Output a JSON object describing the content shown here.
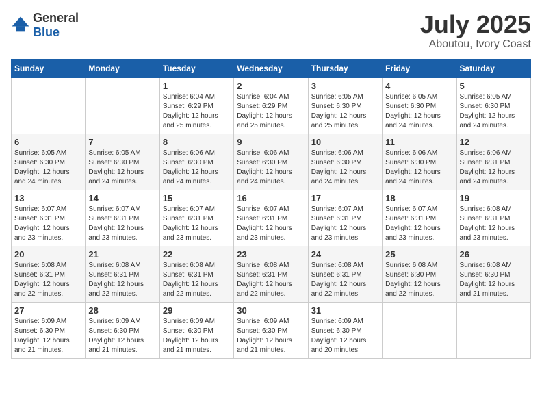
{
  "header": {
    "logo_general": "General",
    "logo_blue": "Blue",
    "month": "July 2025",
    "location": "Aboutou, Ivory Coast"
  },
  "days_of_week": [
    "Sunday",
    "Monday",
    "Tuesday",
    "Wednesday",
    "Thursday",
    "Friday",
    "Saturday"
  ],
  "weeks": [
    [
      {
        "day": "",
        "info": ""
      },
      {
        "day": "",
        "info": ""
      },
      {
        "day": "1",
        "info": "Sunrise: 6:04 AM\nSunset: 6:29 PM\nDaylight: 12 hours and 25 minutes."
      },
      {
        "day": "2",
        "info": "Sunrise: 6:04 AM\nSunset: 6:29 PM\nDaylight: 12 hours and 25 minutes."
      },
      {
        "day": "3",
        "info": "Sunrise: 6:05 AM\nSunset: 6:30 PM\nDaylight: 12 hours and 25 minutes."
      },
      {
        "day": "4",
        "info": "Sunrise: 6:05 AM\nSunset: 6:30 PM\nDaylight: 12 hours and 24 minutes."
      },
      {
        "day": "5",
        "info": "Sunrise: 6:05 AM\nSunset: 6:30 PM\nDaylight: 12 hours and 24 minutes."
      }
    ],
    [
      {
        "day": "6",
        "info": "Sunrise: 6:05 AM\nSunset: 6:30 PM\nDaylight: 12 hours and 24 minutes."
      },
      {
        "day": "7",
        "info": "Sunrise: 6:05 AM\nSunset: 6:30 PM\nDaylight: 12 hours and 24 minutes."
      },
      {
        "day": "8",
        "info": "Sunrise: 6:06 AM\nSunset: 6:30 PM\nDaylight: 12 hours and 24 minutes."
      },
      {
        "day": "9",
        "info": "Sunrise: 6:06 AM\nSunset: 6:30 PM\nDaylight: 12 hours and 24 minutes."
      },
      {
        "day": "10",
        "info": "Sunrise: 6:06 AM\nSunset: 6:30 PM\nDaylight: 12 hours and 24 minutes."
      },
      {
        "day": "11",
        "info": "Sunrise: 6:06 AM\nSunset: 6:30 PM\nDaylight: 12 hours and 24 minutes."
      },
      {
        "day": "12",
        "info": "Sunrise: 6:06 AM\nSunset: 6:31 PM\nDaylight: 12 hours and 24 minutes."
      }
    ],
    [
      {
        "day": "13",
        "info": "Sunrise: 6:07 AM\nSunset: 6:31 PM\nDaylight: 12 hours and 23 minutes."
      },
      {
        "day": "14",
        "info": "Sunrise: 6:07 AM\nSunset: 6:31 PM\nDaylight: 12 hours and 23 minutes."
      },
      {
        "day": "15",
        "info": "Sunrise: 6:07 AM\nSunset: 6:31 PM\nDaylight: 12 hours and 23 minutes."
      },
      {
        "day": "16",
        "info": "Sunrise: 6:07 AM\nSunset: 6:31 PM\nDaylight: 12 hours and 23 minutes."
      },
      {
        "day": "17",
        "info": "Sunrise: 6:07 AM\nSunset: 6:31 PM\nDaylight: 12 hours and 23 minutes."
      },
      {
        "day": "18",
        "info": "Sunrise: 6:07 AM\nSunset: 6:31 PM\nDaylight: 12 hours and 23 minutes."
      },
      {
        "day": "19",
        "info": "Sunrise: 6:08 AM\nSunset: 6:31 PM\nDaylight: 12 hours and 23 minutes."
      }
    ],
    [
      {
        "day": "20",
        "info": "Sunrise: 6:08 AM\nSunset: 6:31 PM\nDaylight: 12 hours and 22 minutes."
      },
      {
        "day": "21",
        "info": "Sunrise: 6:08 AM\nSunset: 6:31 PM\nDaylight: 12 hours and 22 minutes."
      },
      {
        "day": "22",
        "info": "Sunrise: 6:08 AM\nSunset: 6:31 PM\nDaylight: 12 hours and 22 minutes."
      },
      {
        "day": "23",
        "info": "Sunrise: 6:08 AM\nSunset: 6:31 PM\nDaylight: 12 hours and 22 minutes."
      },
      {
        "day": "24",
        "info": "Sunrise: 6:08 AM\nSunset: 6:31 PM\nDaylight: 12 hours and 22 minutes."
      },
      {
        "day": "25",
        "info": "Sunrise: 6:08 AM\nSunset: 6:30 PM\nDaylight: 12 hours and 22 minutes."
      },
      {
        "day": "26",
        "info": "Sunrise: 6:08 AM\nSunset: 6:30 PM\nDaylight: 12 hours and 21 minutes."
      }
    ],
    [
      {
        "day": "27",
        "info": "Sunrise: 6:09 AM\nSunset: 6:30 PM\nDaylight: 12 hours and 21 minutes."
      },
      {
        "day": "28",
        "info": "Sunrise: 6:09 AM\nSunset: 6:30 PM\nDaylight: 12 hours and 21 minutes."
      },
      {
        "day": "29",
        "info": "Sunrise: 6:09 AM\nSunset: 6:30 PM\nDaylight: 12 hours and 21 minutes."
      },
      {
        "day": "30",
        "info": "Sunrise: 6:09 AM\nSunset: 6:30 PM\nDaylight: 12 hours and 21 minutes."
      },
      {
        "day": "31",
        "info": "Sunrise: 6:09 AM\nSunset: 6:30 PM\nDaylight: 12 hours and 20 minutes."
      },
      {
        "day": "",
        "info": ""
      },
      {
        "day": "",
        "info": ""
      }
    ]
  ]
}
